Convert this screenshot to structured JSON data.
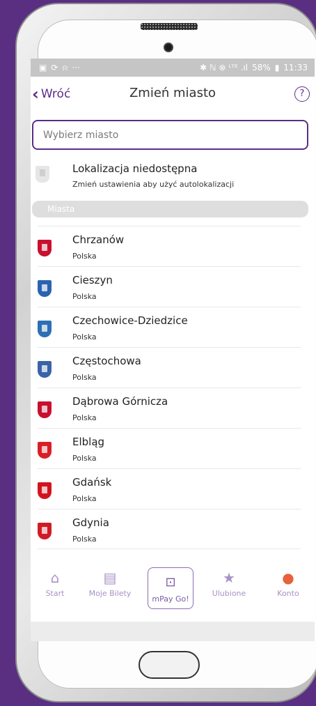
{
  "status_bar": {
    "left_icons": [
      "image-icon",
      "sync-icon",
      "bell-icon",
      "more-icon"
    ],
    "left_symbols": [
      "▣",
      "⟳",
      "⍾",
      "···"
    ],
    "right_symbols": "✱ ℕ ⊗ ᴸᵀᴱ .ıl",
    "battery": "58%",
    "time": "11:33"
  },
  "header": {
    "back_label": "Wróć",
    "title": "Zmień miasto",
    "help_symbol": "?"
  },
  "search": {
    "placeholder": "Wybierz miasto"
  },
  "location": {
    "title": "Lokalizacja niedostępna",
    "subtitle": "Zmień ustawienia aby użyć autolokalizacji"
  },
  "section": {
    "title": "Miasta"
  },
  "cities": [
    {
      "name": "Chrzanów",
      "country": "Polska",
      "color": "#c8102e"
    },
    {
      "name": "Cieszyn",
      "country": "Polska",
      "color": "#2b63b0"
    },
    {
      "name": "Czechowice-Dziedzice",
      "country": "Polska",
      "color": "#2d6fb5"
    },
    {
      "name": "Częstochowa",
      "country": "Polska",
      "color": "#3a64a8"
    },
    {
      "name": "Dąbrowa Górnicza",
      "country": "Polska",
      "color": "#c8102e"
    },
    {
      "name": "Elbląg",
      "country": "Polska",
      "color": "#d91f26"
    },
    {
      "name": "Gdańsk",
      "country": "Polska",
      "color": "#d1151f"
    },
    {
      "name": "Gdynia",
      "country": "Polska",
      "color": "#d11b24"
    }
  ],
  "tabs": {
    "start": "Start",
    "tickets": "Moje Bilety",
    "mpay_go": "mPay Go!",
    "favorites": "Ulubione",
    "account": "Konto"
  },
  "colors": {
    "brand": "#5b2d86",
    "tab_inactive": "#a991c6",
    "account_accent": "#e8603c"
  }
}
